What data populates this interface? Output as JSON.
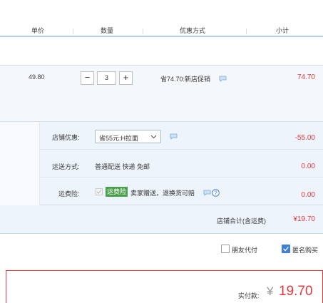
{
  "header": {
    "col_price": "单价",
    "col_qty": "数量",
    "col_promo": "优惠方式",
    "col_subtotal": "小计"
  },
  "item": {
    "price": "49.80",
    "quantity": "3",
    "minus_label": "−",
    "plus_label": "+",
    "promo": "省74.70:新店促销",
    "subtotal": "74.70"
  },
  "shop": {
    "coupon_label": "店铺优惠:",
    "coupon_selected": "省55元:H拉面",
    "coupon_amount": "-55.00",
    "shipping_label": "运送方式:",
    "shipping_value": "普通配送 快递 免邮",
    "shipping_amount": "0.00",
    "insurance_label": "运费险:",
    "insurance_badge": "运费险",
    "insurance_text": "卖家赠送，退换货可赔",
    "insurance_amount": "0.00",
    "total_label": "店铺合计(含运费)",
    "total_amount": "¥19.70"
  },
  "options": {
    "friend_pay_label": "朋友代付",
    "friend_pay_checked": false,
    "anonymous_label": "匿名购买",
    "anonymous_checked": true
  },
  "payment": {
    "label": "实付款:",
    "currency": "¥",
    "amount": "19.70"
  },
  "colors": {
    "accent_red": "#e4393c",
    "row_bg": "#eef4fb",
    "insurance_green": "#4aa04a",
    "checkbox_blue": "#3d7ee0"
  },
  "icons": [
    "chat-icon",
    "chevron-down-icon",
    "help-icon",
    "check-icon"
  ]
}
